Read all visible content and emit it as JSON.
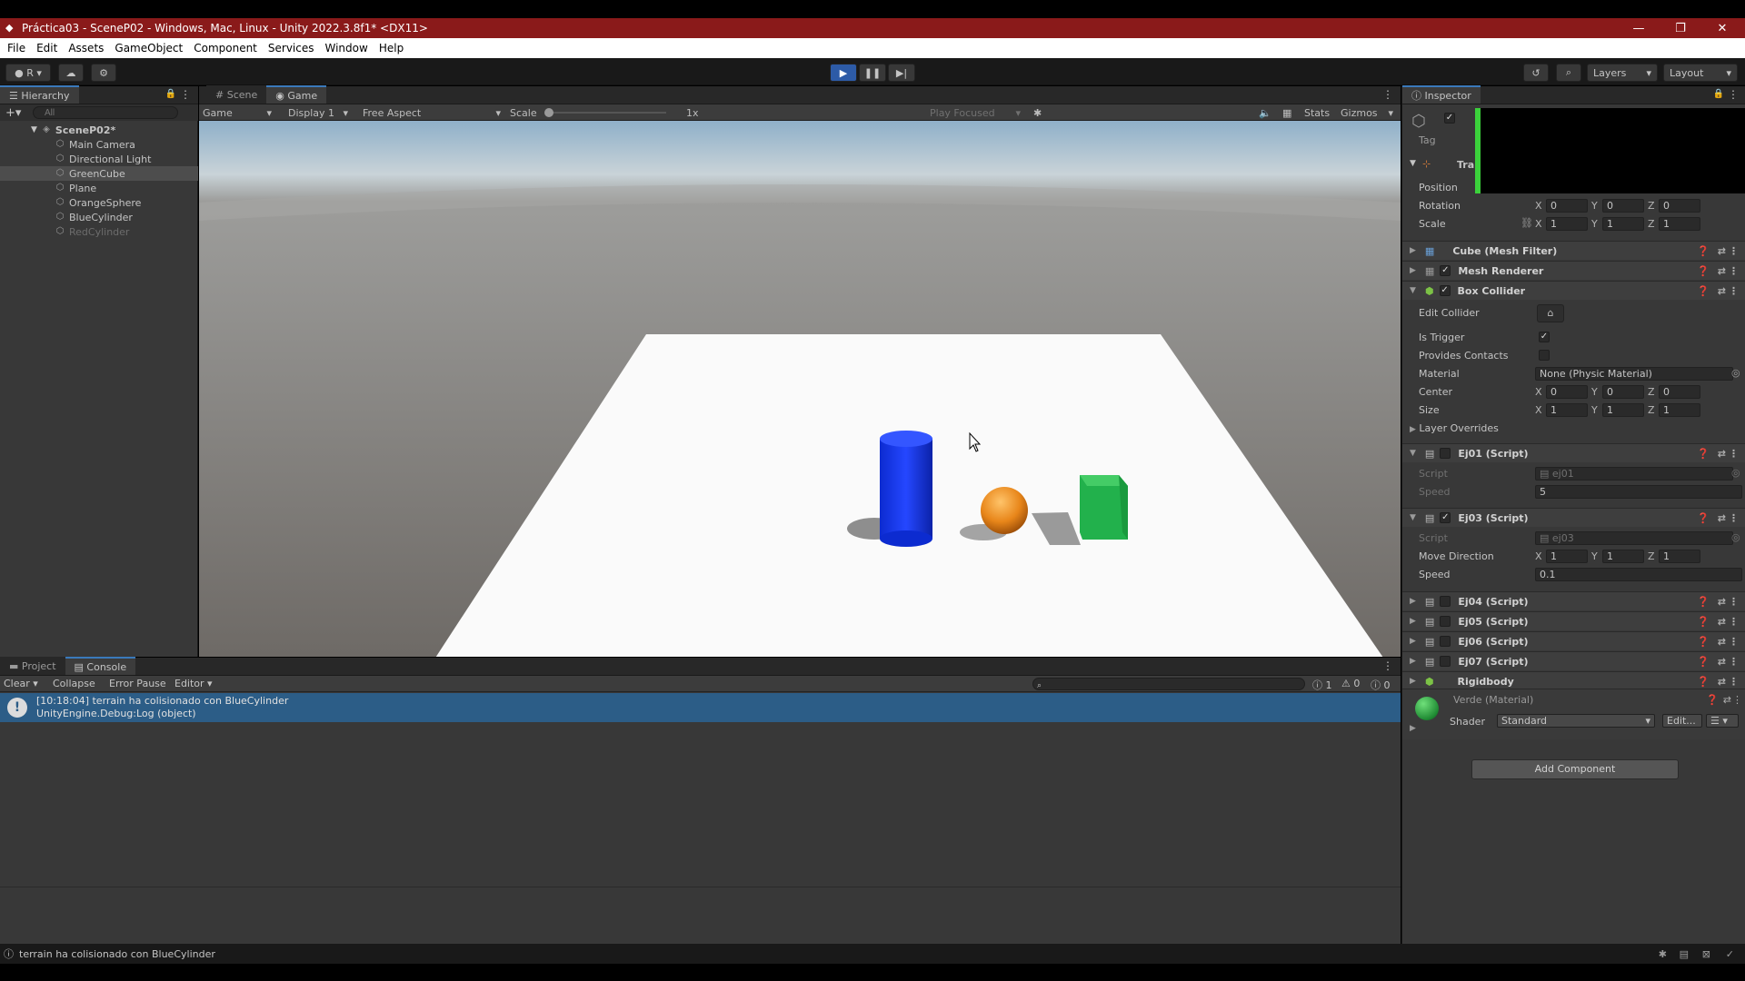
{
  "window": {
    "title": "Práctica03 - SceneP02 - Windows, Mac, Linux - Unity 2022.3.8f1* <DX11>",
    "minimize": "—",
    "restore": "❐",
    "close": "✕"
  },
  "menu": [
    "File",
    "Edit",
    "Assets",
    "GameObject",
    "Component",
    "Services",
    "Window",
    "Help"
  ],
  "toolbar": {
    "account": "R",
    "layers": "Layers",
    "layout": "Layout"
  },
  "hierarchy": {
    "tab": "Hierarchy",
    "search_placeholder": "All",
    "scene": "SceneP02*",
    "items": [
      {
        "label": "Main Camera",
        "state": "normal"
      },
      {
        "label": "Directional Light",
        "state": "normal"
      },
      {
        "label": "GreenCube",
        "state": "selected"
      },
      {
        "label": "Plane",
        "state": "normal"
      },
      {
        "label": "OrangeSphere",
        "state": "normal"
      },
      {
        "label": "BlueCylinder",
        "state": "normal"
      },
      {
        "label": "RedCylinder",
        "state": "disabled"
      }
    ]
  },
  "game": {
    "tabs": [
      "Scene",
      "Game"
    ],
    "active_tab": "Game",
    "mode": "Game",
    "display": "Display 1",
    "aspect": "Free Aspect",
    "scale_label": "Scale",
    "scale_value": "1x",
    "play_focused": "Play Focused",
    "stats": "Stats",
    "gizmos": "Gizmos"
  },
  "bottom": {
    "tabs": [
      "Project",
      "Console"
    ],
    "active_tab": "Console",
    "buttons": [
      "Clear",
      "Collapse",
      "Error Pause",
      "Editor"
    ],
    "counts": {
      "info": "1",
      "warn": "0",
      "error": "0"
    },
    "log": {
      "line1": "[10:18:04] terrain ha colisionado con BlueCylinder",
      "line2": "UnityEngine.Debug:Log (object)"
    }
  },
  "inspector": {
    "tab": "Inspector",
    "tag_label": "Tag",
    "transform": {
      "title": "Tra",
      "position_label": "Position",
      "rotation_label": "Rotation",
      "scale_label": "Scale",
      "rotation": {
        "x": "0",
        "y": "0",
        "z": "0"
      },
      "scale": {
        "x": "1",
        "y": "1",
        "z": "1"
      }
    },
    "components": {
      "mesh_filter": "Cube (Mesh Filter)",
      "mesh_renderer": "Mesh Renderer",
      "box_collider": "Box Collider",
      "ej01": "Ej01 (Script)",
      "ej03": "Ej03 (Script)",
      "ej04": "Ej04 (Script)",
      "ej05": "Ej05 (Script)",
      "ej06": "Ej06 (Script)",
      "ej07": "Ej07 (Script)",
      "rigidbody": "Rigidbody"
    },
    "box_collider": {
      "edit_collider": "Edit Collider",
      "is_trigger": "Is Trigger",
      "provides_contacts": "Provides Contacts",
      "material_label": "Material",
      "material_value": "None (Physic Material)",
      "center_label": "Center",
      "center": {
        "x": "0",
        "y": "0",
        "z": "0"
      },
      "size_label": "Size",
      "size": {
        "x": "1",
        "y": "1",
        "z": "1"
      },
      "layer_overrides": "Layer Overrides"
    },
    "ej01": {
      "script_label": "Script",
      "script_value": "ej01",
      "speed_label": "Speed",
      "speed_value": "5"
    },
    "ej03": {
      "script_label": "Script",
      "script_value": "ej03",
      "move_label": "Move Direction",
      "move": {
        "x": "1",
        "y": "1",
        "z": "1"
      },
      "speed_label": "Speed",
      "speed_value": "0.1"
    },
    "material": {
      "name": "Verde (Material)",
      "shader_label": "Shader",
      "shader_value": "Standard",
      "edit": "Edit..."
    },
    "add_component": "Add Component"
  },
  "status": {
    "message": "terrain ha colisionado con BlueCylinder"
  },
  "colors": {
    "accent": "#3a79bb",
    "selected_row": "#4d4d4d",
    "title_red": "#8a1a1a",
    "cube_green": "#22b14c",
    "cylinder_blue": "#1a3be0",
    "sphere_orange": "#e8861a"
  }
}
